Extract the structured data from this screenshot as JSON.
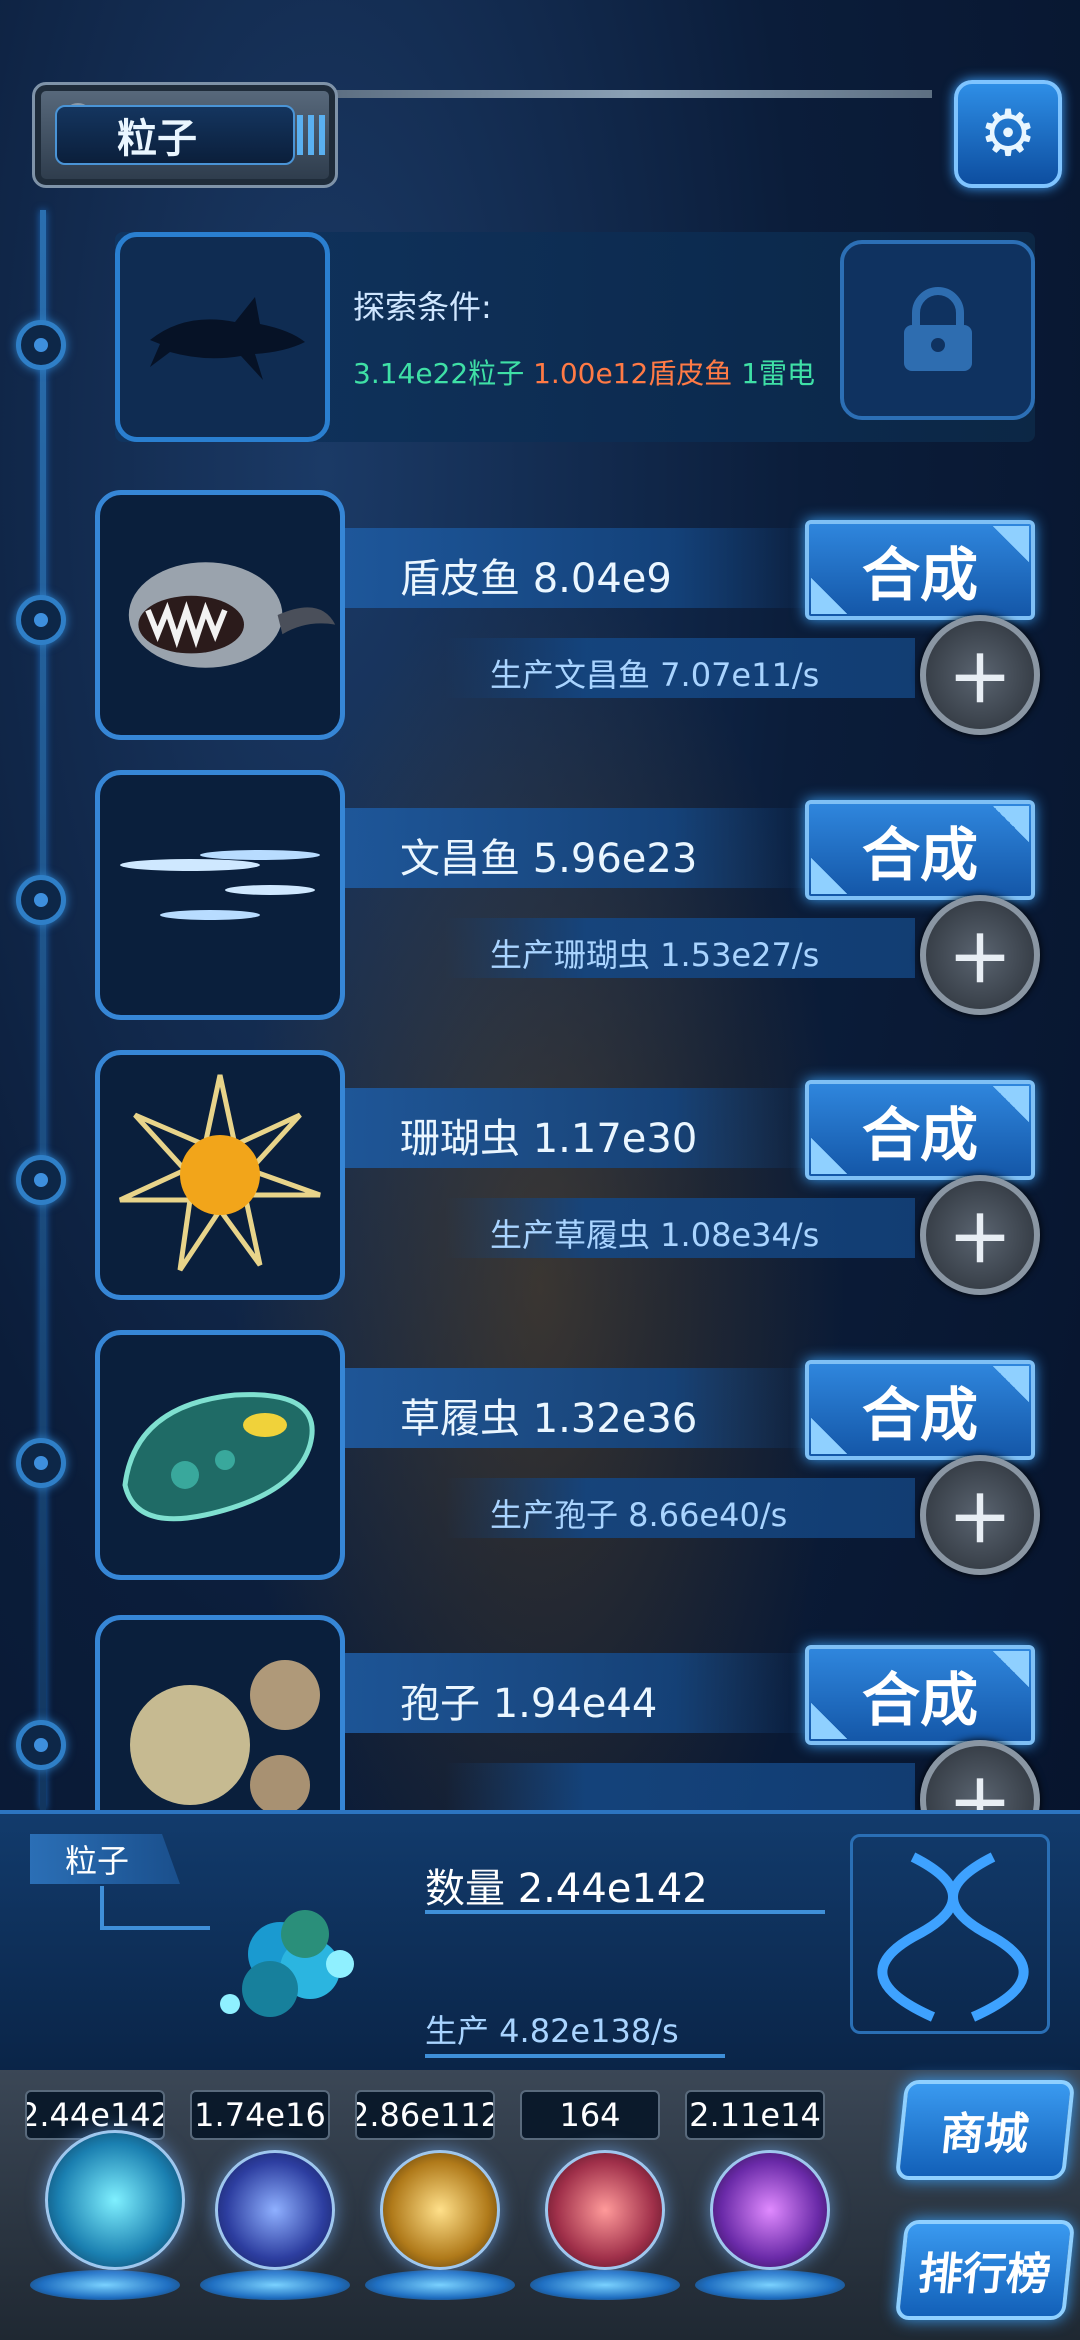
{
  "header": {
    "title": "粒子"
  },
  "explore": {
    "label": "探索条件:",
    "cond_particles": "3.14e22粒子",
    "cond_fish": "1.00e12盾皮鱼",
    "cond_thunder": "1雷电"
  },
  "creatures": [
    {
      "name": "盾皮鱼 8.04e9",
      "produce": "生产文昌鱼 7.07e11/s",
      "synth": "合成"
    },
    {
      "name": "文昌鱼 5.96e23",
      "produce": "生产珊瑚虫 1.53e27/s",
      "synth": "合成"
    },
    {
      "name": "珊瑚虫 1.17e30",
      "produce": "生产草履虫 1.08e34/s",
      "synth": "合成"
    },
    {
      "name": "草履虫 1.32e36",
      "produce": "生产孢子 8.66e40/s",
      "synth": "合成"
    },
    {
      "name": "孢子 1.94e44",
      "produce": "",
      "synth": "合成"
    }
  ],
  "resource": {
    "tag": "粒子",
    "count": "数量 2.44e142",
    "produce": "生产 4.82e138/s"
  },
  "nav": {
    "values": [
      "2.44e142",
      "1.74e16",
      "2.86e112",
      "164",
      "2.11e14"
    ],
    "shop": "商城",
    "rank": "排行榜"
  },
  "colors": {
    "accent": "#2f86dd",
    "green": "#3fe0a6",
    "orange": "#ff7a45"
  }
}
